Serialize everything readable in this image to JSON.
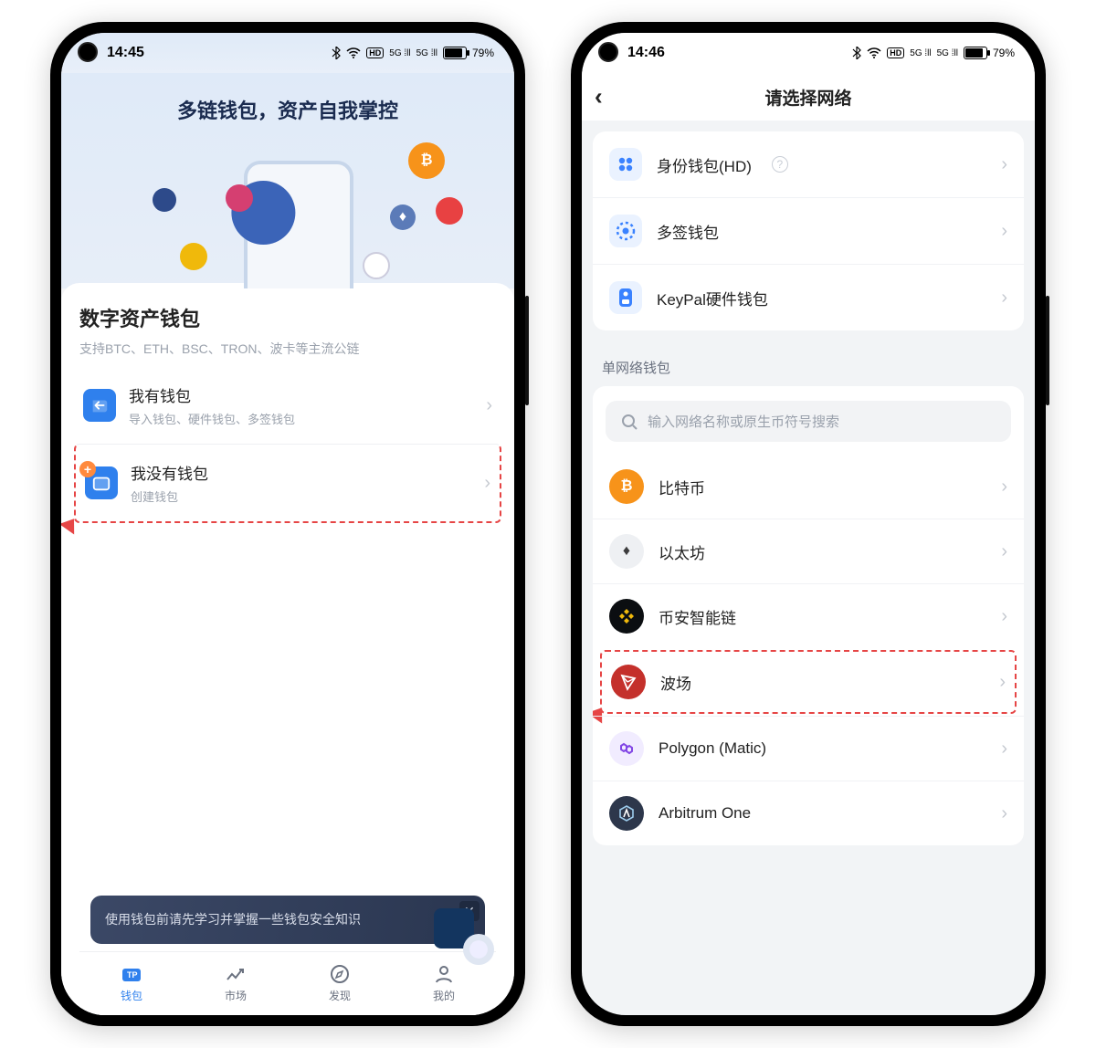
{
  "phone1": {
    "status": {
      "time": "14:45",
      "battery": "79%"
    },
    "hero_title": "多链钱包，资产自我掌控",
    "card_title": "数字资产钱包",
    "card_sub": "支持BTC、ETH、BSC、TRON、波卡等主流公链",
    "row_have": {
      "title": "我有钱包",
      "sub": "导入钱包、硬件钱包、多签钱包"
    },
    "row_none": {
      "title": "我没有钱包",
      "sub": "创建钱包"
    },
    "banner": "使用钱包前请先学习并掌握一些钱包安全知识",
    "tabs": {
      "wallet": "钱包",
      "market": "市场",
      "discover": "发现",
      "me": "我的"
    }
  },
  "phone2": {
    "status": {
      "time": "14:46",
      "battery": "79%"
    },
    "nav_title": "请选择网络",
    "group": {
      "hd": "身份钱包(HD)",
      "multisig": "多签钱包",
      "keypal": "KeyPal硬件钱包"
    },
    "section": "单网络钱包",
    "search_placeholder": "输入网络名称或原生币符号搜索",
    "networks": {
      "btc": "比特币",
      "eth": "以太坊",
      "bsc": "币安智能链",
      "tron": "波场",
      "polygon": "Polygon (Matic)",
      "arbitrum": "Arbitrum One"
    }
  }
}
